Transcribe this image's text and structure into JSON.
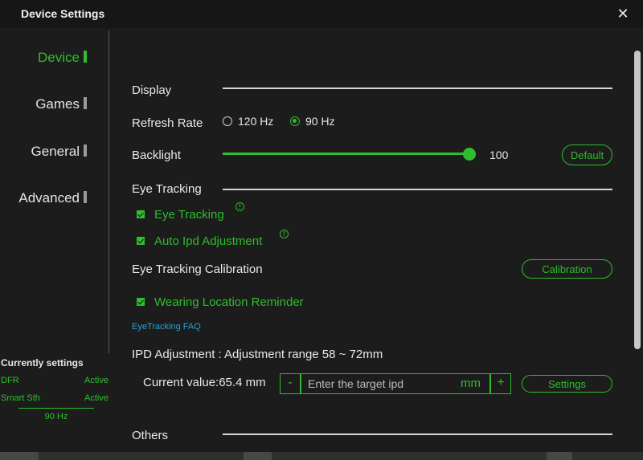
{
  "window": {
    "title": "Device Settings",
    "close_glyph": "✕"
  },
  "sidebar": {
    "items": [
      {
        "label": "Device",
        "active": true
      },
      {
        "label": "Games",
        "active": false
      },
      {
        "label": "General",
        "active": false
      },
      {
        "label": "Advanced",
        "active": false
      }
    ]
  },
  "current_settings": {
    "title": "Currently settings",
    "rows": [
      {
        "name": "DFR",
        "status": "Active"
      },
      {
        "name": "Smart Sth",
        "status": "Active"
      }
    ],
    "refresh": "90 Hz"
  },
  "display": {
    "section": "Display",
    "refresh_rate": {
      "label": "Refresh Rate",
      "options": [
        "120 Hz",
        "90 Hz"
      ],
      "selected": "90 Hz"
    },
    "backlight": {
      "label": "Backlight",
      "value": "100",
      "fraction": 1.0,
      "default_button": "Default"
    }
  },
  "eye_tracking": {
    "section": "Eye Tracking",
    "eye_tracking_label": "Eye Tracking",
    "auto_ipd_label": "Auto Ipd Adjustment",
    "calibration_label": "Eye Tracking Calibration",
    "calibration_button": "Calibration",
    "wearing_reminder_label": "Wearing Location Reminder",
    "faq_link": "EyeTracking FAQ",
    "info_glyph": "!"
  },
  "ipd": {
    "title": "IPD Adjustment : Adjustment range 58 ~ 72mm",
    "current_value": "Current value:65.4 mm",
    "minus": "-",
    "plus": "+",
    "placeholder": "Enter the target ipd",
    "unit": "mm",
    "settings_button": "Settings"
  },
  "others": {
    "section": "Others"
  },
  "colors": {
    "accent": "#2dbd2d",
    "link": "#29a0d8",
    "background": "#1c1c1c"
  }
}
